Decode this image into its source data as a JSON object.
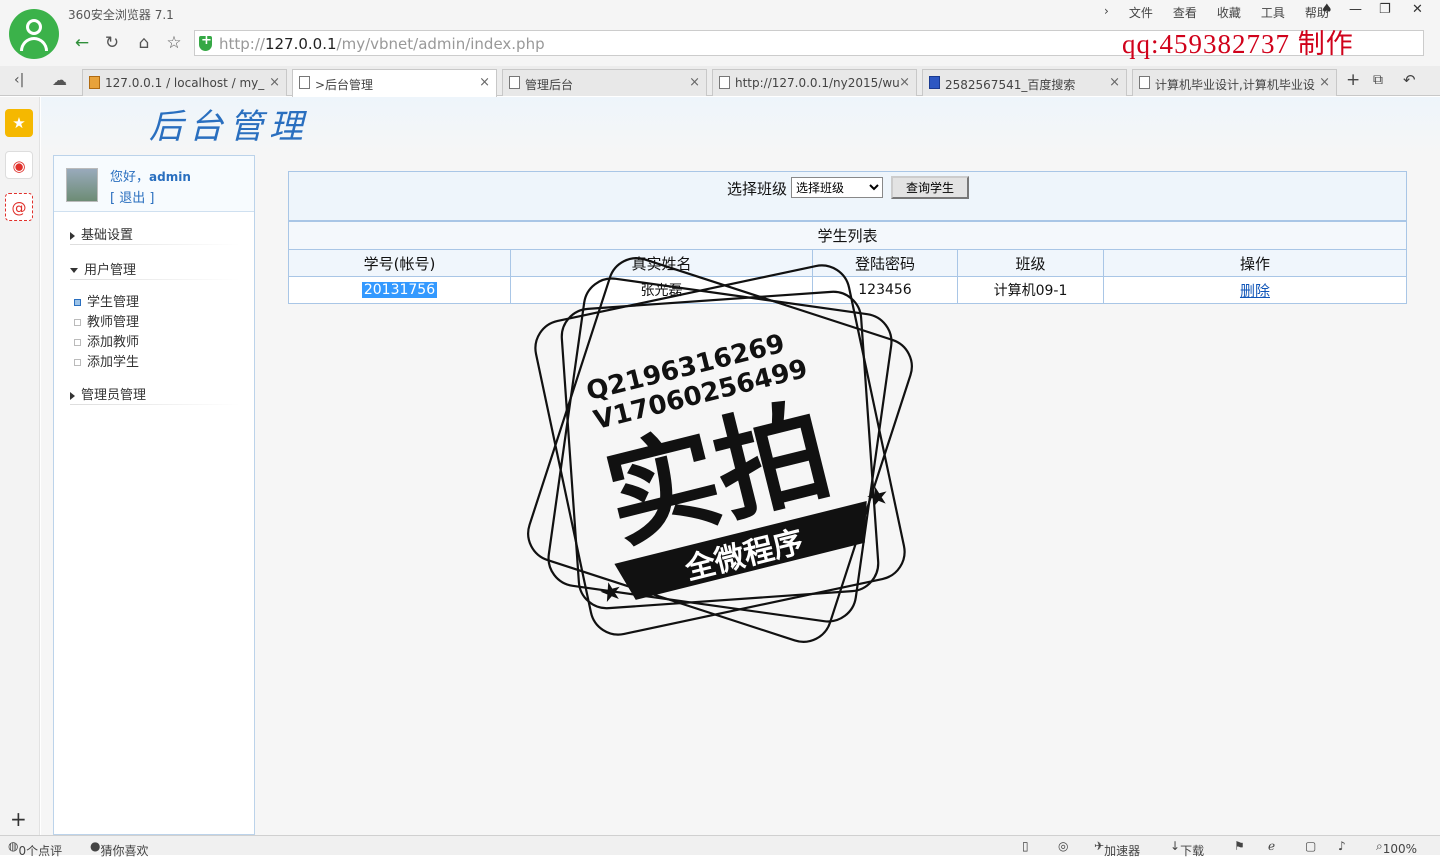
{
  "browser": {
    "title": "360安全浏览器 7.1",
    "menu": [
      "文件",
      "查看",
      "收藏",
      "工具",
      "帮助"
    ],
    "url_host": "127.0.0.1",
    "url_prefix": "http://",
    "url_path": "/my/vbnet/admin/index.php",
    "overlay_text": "qq:459382737  制作",
    "tabs": [
      {
        "label": "127.0.0.1 / localhost / my_",
        "icon": "phpmyadmin-icon"
      },
      {
        "label": ">后台管理",
        "icon": "page-icon",
        "active": true
      },
      {
        "label": "管理后台",
        "icon": "page-icon"
      },
      {
        "label": "http://127.0.0.1/ny2015/wu",
        "icon": "page-icon"
      },
      {
        "label": "2582567541_百度搜索",
        "icon": "baidu-paw-icon"
      },
      {
        "label": "计算机毕业设计,计算机毕业设",
        "icon": "page-icon"
      }
    ]
  },
  "page": {
    "banner_title": "后台管理",
    "user": {
      "greeting": "您好，",
      "name": "admin",
      "logout": "[ 退出 ]"
    },
    "nav": {
      "basic": "基础设置",
      "user_mgmt": "用户管理",
      "items": [
        "学生管理",
        "教师管理",
        "添加教师",
        "添加学生"
      ],
      "admin_mgmt": "管理员管理"
    },
    "search": {
      "label": "选择班级",
      "select_value": "选择班级",
      "button": "查询学生"
    },
    "table": {
      "caption": "学生列表",
      "headers": [
        "学号(帐号)",
        "真实姓名",
        "登陆密码",
        "班级",
        "操作"
      ],
      "rows": [
        {
          "id": "20131756",
          "name": "张光磊",
          "password": "123456",
          "class": "计算机09-1",
          "action": "删除"
        }
      ]
    },
    "watermark": {
      "line1": "Q2196316269",
      "line2": "V17060256499",
      "big": "实拍",
      "banner": "全微程序"
    }
  },
  "statusbar": {
    "comments": "0个点评",
    "guess": "猜你喜欢",
    "accelerator": "加速器",
    "download": "下载",
    "zoom": "100%"
  }
}
